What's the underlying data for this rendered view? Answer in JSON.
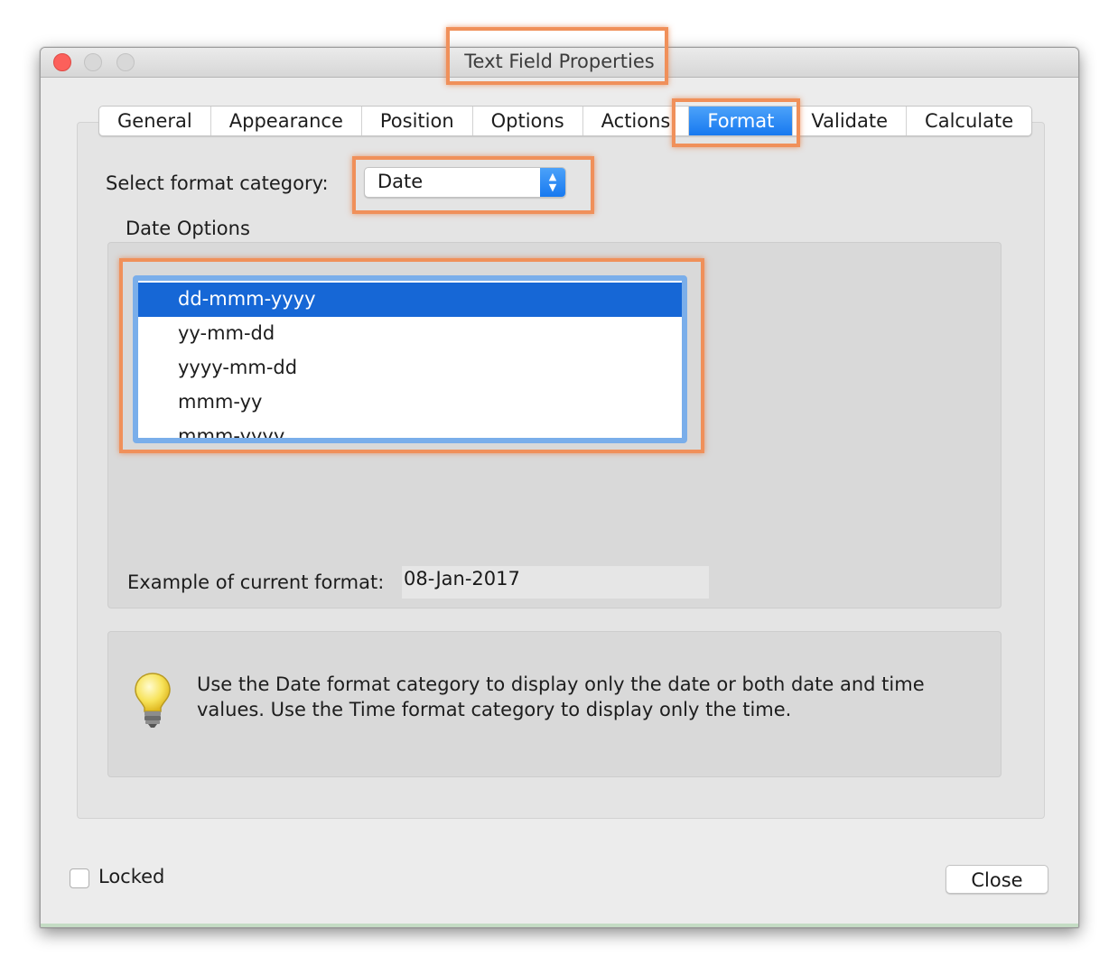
{
  "window": {
    "title": "Text Field Properties"
  },
  "tabs": [
    {
      "label": "General"
    },
    {
      "label": "Appearance"
    },
    {
      "label": "Position"
    },
    {
      "label": "Options"
    },
    {
      "label": "Actions"
    },
    {
      "label": "Format",
      "active": true
    },
    {
      "label": "Validate"
    },
    {
      "label": "Calculate"
    }
  ],
  "format": {
    "category_label": "Select format category:",
    "category_value": "Date",
    "options_heading": "Date Options",
    "date_formats": [
      "dd-mmm-yyyy",
      "yy-mm-dd",
      "yyyy-mm-dd",
      "mmm-yy",
      "mmm-yyyy"
    ],
    "selected_format": "dd-mmm-yyyy",
    "example_label": "Example of current format:",
    "example_value": "08-Jan-2017"
  },
  "tip": {
    "icon": "lightbulb-icon",
    "text": "Use the Date format category to display only the date or both date and time values. Use the Time format category to display only the time."
  },
  "footer": {
    "locked_label": "Locked",
    "locked_checked": false,
    "close_label": "Close"
  },
  "colors": {
    "accent": "#1779f0",
    "selection": "#1667d6",
    "highlight": "#f0905a"
  }
}
